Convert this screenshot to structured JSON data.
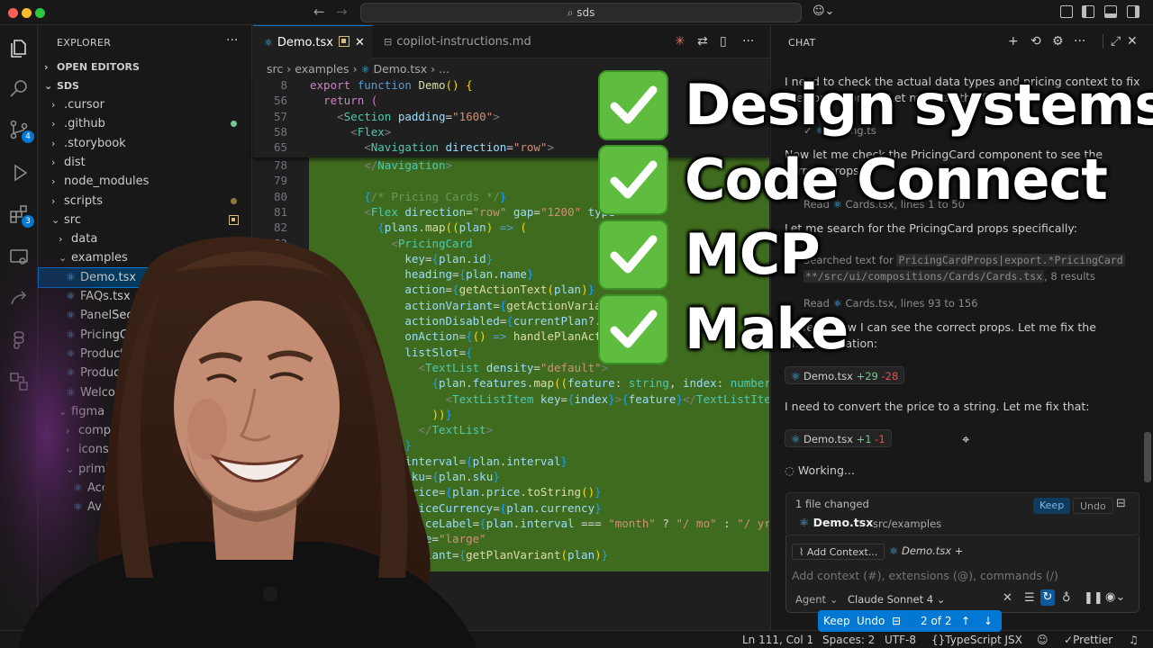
{
  "titlebar": {
    "search": "sds"
  },
  "activity": {
    "scm_badge": "4",
    "ext_badge": "3"
  },
  "explorer": {
    "title": "EXPLORER",
    "more": "···",
    "sections": {
      "open_editors": "OPEN EDITORS",
      "root": "SDS"
    },
    "items": [
      {
        "label": ".cursor",
        "indent": 1,
        "chev": "›"
      },
      {
        "label": ".github",
        "indent": 1,
        "chev": "›"
      },
      {
        "label": ".storybook",
        "indent": 1,
        "chev": "›"
      },
      {
        "label": "dist",
        "indent": 1,
        "chev": "›"
      },
      {
        "label": "node_modules",
        "indent": 1,
        "chev": "›"
      },
      {
        "label": "scripts",
        "indent": 1,
        "chev": "›"
      },
      {
        "label": "src",
        "indent": 1,
        "chev": "⌄"
      },
      {
        "label": "data",
        "indent": 2,
        "chev": "›"
      },
      {
        "label": "examples",
        "indent": 2,
        "chev": "⌄"
      },
      {
        "label": "Demo.tsx",
        "indent": 3,
        "chev": ""
      },
      {
        "label": "FAQs.tsx",
        "indent": 3,
        "chev": ""
      },
      {
        "label": "PanelSections.tsx",
        "indent": 3,
        "chev": ""
      },
      {
        "label": "PricingGrid.tsx",
        "indent": 3,
        "chev": ""
      },
      {
        "label": "ProductDetails.tsx",
        "indent": 3,
        "chev": ""
      },
      {
        "label": "ProductGrid.tsx",
        "indent": 3,
        "chev": ""
      },
      {
        "label": "Welcome.tsx",
        "indent": 3,
        "chev": ""
      },
      {
        "label": "figma",
        "indent": 2,
        "chev": "⌄"
      },
      {
        "label": "compositions",
        "indent": 3,
        "chev": "›"
      },
      {
        "label": "icons",
        "indent": 3,
        "chev": "›"
      },
      {
        "label": "primitives",
        "indent": 3,
        "chev": "⌄"
      },
      {
        "label": "Accordion.figma.tsx",
        "indent": 4,
        "chev": ""
      },
      {
        "label": "Avatar.figma.tsx",
        "indent": 4,
        "chev": ""
      }
    ]
  },
  "editor": {
    "tabs": [
      {
        "label": "Demo.tsx"
      },
      {
        "label": "copilot-instructions.md"
      }
    ],
    "breadcrumb": [
      "src",
      "examples",
      "Demo.tsx",
      "..."
    ],
    "sticky_numbers": [
      "8",
      "56",
      "57",
      "58",
      "65"
    ],
    "line_numbers": [
      "78",
      "79",
      "80",
      "81",
      "82",
      "83",
      "",
      "",
      "",
      "",
      "",
      "",
      "",
      "",
      "",
      "",
      "",
      "",
      "",
      "",
      "",
      "",
      "",
      "",
      "",
      "",
      ""
    ],
    "inline": {
      "keep": "Keep",
      "undo": "Undo",
      "count": "2 of 2"
    }
  },
  "chat": {
    "title": "CHAT",
    "msg1": "I need to check the actual data types and pricing context to fix",
    "msg1b": "the correct props. Let me read the file first:",
    "read1": "pricing.ts",
    "msg2": "Now let me check the PricingCard component to see the correct props:",
    "read2_label": "Read",
    "read2_file": "Cards.tsx",
    "read2_lines": ", lines 1 to 50",
    "msg3": "Let me search for the PricingCard props specifically:",
    "search_prefix": "Searched text for",
    "search_query": "PricingCardProps|export.*PricingCard",
    "search_path": "**/src/ui/compositions/Cards/Cards.tsx",
    "search_results": ", 8 results",
    "read3_label": "Read",
    "read3_file": "Cards.tsx",
    "read3_lines": ", lines 93 to 156",
    "msg4": "Perfect! Now I can see the correct props. Let me fix the",
    "msg4b": "implementation:",
    "chip1": {
      "file": "Demo.tsx",
      "plus": "+29",
      "minus": "-28"
    },
    "msg5": "I need to convert the price to a string. Let me fix that:",
    "chip2": {
      "file": "Demo.tsx",
      "plus": "+1",
      "minus": "-1"
    },
    "working": "Working...",
    "changed": "1 file changed",
    "keep": "Keep",
    "undo": "Undo",
    "changed_file": "Demo.tsx",
    "changed_path": "src/examples",
    "add_context": "Add Context...",
    "context_file": "Demo.tsx",
    "placeholder": "Add context (#), extensions (@), commands (/)",
    "mode": "Agent",
    "model": "Claude Sonnet 4"
  },
  "status": {
    "position": "Ln 111, Col 1",
    "spaces": "Spaces: 2",
    "encoding": "UTF-8",
    "language": "TypeScript JSX",
    "prettier": "Prettier"
  },
  "overlay": {
    "items": [
      "Design systems",
      "Code Connect",
      "MCP",
      "Make"
    ],
    "check_color": "#5ebd3e"
  }
}
